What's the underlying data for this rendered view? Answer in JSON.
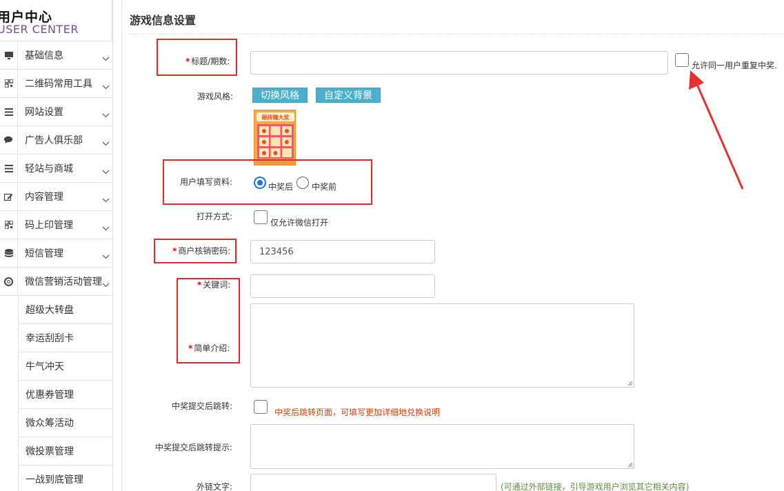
{
  "sidebar": {
    "brand_cn": "用户中心",
    "brand_en": "USER CENTER",
    "menu": [
      {
        "label": "基础信息",
        "icon": "monitor-icon"
      },
      {
        "label": "二维码常用工具",
        "icon": "qrcode-icon"
      },
      {
        "label": "网站设置",
        "icon": "list-icon"
      },
      {
        "label": "广告人俱乐部",
        "icon": "chat-icon"
      },
      {
        "label": "轻站与商城",
        "icon": "list-icon"
      },
      {
        "label": "内容管理",
        "icon": "edit-icon"
      },
      {
        "label": "码上印管理",
        "icon": "qrcode-icon"
      },
      {
        "label": "短信管理",
        "icon": "database-icon"
      },
      {
        "label": "微信营销活动管理",
        "icon": "lifebuoy-icon"
      }
    ],
    "submenu": [
      "超级大转盘",
      "幸运刮刮卡",
      "牛气冲天",
      "优惠券管理",
      "微众筹活动",
      "微投票管理",
      "一战到底管理"
    ]
  },
  "main": {
    "section_title": "游戏信息设置",
    "fields": {
      "title_label": "标题/期数:",
      "allow_repeat_label": "允许同一用户重复中奖.",
      "game_style_label": "游戏风格:",
      "switch_style_btn": "切换风格",
      "custom_bg_btn": "自定义背景",
      "thumb_caption": "砸砖赚大奖",
      "fill_info_label": "用户填写资料:",
      "after_win": "中奖后",
      "before_win": "中奖前",
      "open_mode_label": "打开方式:",
      "wechat_only": "仅允许微信打开",
      "merchant_pwd_label": "商户核销密码:",
      "merchant_pwd_value": "123456",
      "keyword_label": "关键词:",
      "intro_label": "简单介绍:",
      "redirect_label": "中奖提交后跳转:",
      "redirect_hint": "中奖后跳转页面，可填写更加详细地兑换说明",
      "redirect_tip_label": "中奖提交后跳转提示:",
      "external_text_label": "外链文字:",
      "external_hint": "(可通过外部链接，引导游戏用户浏览其它相关内容)"
    }
  },
  "colors": {
    "accent_button": "#4cb0cc",
    "annotation_red": "#e02a2a",
    "required_star": "#e60000"
  }
}
